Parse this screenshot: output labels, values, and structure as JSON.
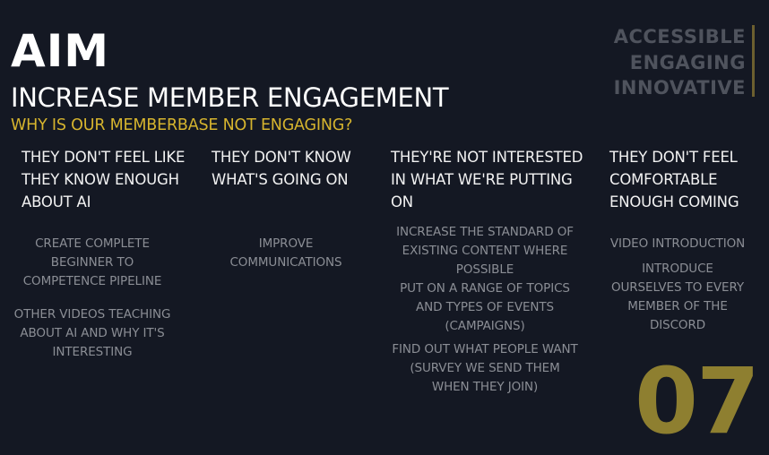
{
  "header": {
    "title": "AIM",
    "subtitle": "INCREASE MEMBER ENGAGEMENT",
    "question": "WHY IS OUR MEMBERBASE NOT ENGAGING?"
  },
  "tags": [
    "ACCESSIBLE",
    "ENGAGING",
    "INNOVATIVE"
  ],
  "columns": [
    {
      "heading": [
        "THEY DON'T FEEL LIKE",
        "THEY KNOW ENOUGH",
        "ABOUT AI"
      ],
      "solutions": [
        [
          "CREATE COMPLETE",
          "BEGINNER TO",
          "COMPETENCE PIPELINE"
        ],
        [
          "OTHER VIDEOS TEACHING",
          "ABOUT AI AND WHY IT'S",
          "INTERESTING"
        ]
      ]
    },
    {
      "heading": [
        "THEY DON'T KNOW",
        "WHAT'S GOING ON"
      ],
      "solutions": [
        [
          "IMPROVE",
          "COMMUNICATIONS"
        ]
      ]
    },
    {
      "heading": [
        "THEY'RE NOT INTERESTED",
        "IN WHAT WE'RE PUTTING",
        "ON"
      ],
      "solutions": [
        [
          "INCREASE THE STANDARD OF",
          "EXISTING CONTENT WHERE",
          "POSSIBLE",
          "PUT ON A RANGE OF TOPICS",
          "AND TYPES OF EVENTS",
          "(CAMPAIGNS)"
        ],
        [
          "FIND OUT WHAT PEOPLE WANT",
          "(SURVEY WE SEND THEM",
          "WHEN THEY JOIN)"
        ]
      ]
    },
    {
      "heading": [
        "THEY DON'T FEEL",
        "COMFORTABLE",
        "ENOUGH COMING"
      ],
      "solutions": [
        [
          "VIDEO INTRODUCTION"
        ],
        [
          "INTRODUCE",
          "OURSELVES TO EVERY",
          "MEMBER OF THE",
          "DISCORD"
        ]
      ]
    }
  ],
  "page_number": "07",
  "colors": {
    "background": "#141823",
    "accent": "#d6b42e",
    "number": "#8e7f30",
    "muted": "#8b8e95"
  }
}
